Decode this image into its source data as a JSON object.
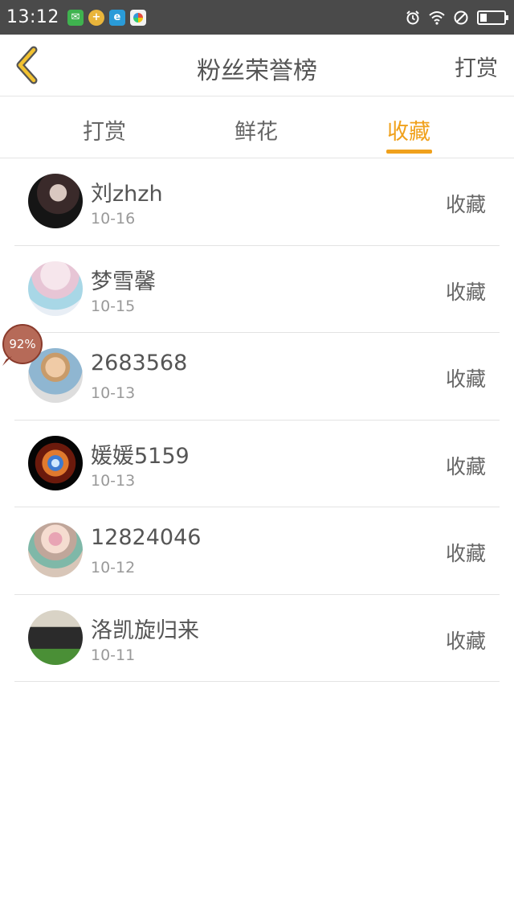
{
  "status_bar": {
    "time": "13:12",
    "battery_level": 0.3,
    "apps": [
      "wechat-icon",
      "plus-app-icon",
      "browser-e-icon",
      "photos-icon"
    ],
    "indicators": [
      "alarm-icon",
      "wifi-icon",
      "dnd-icon",
      "battery-icon"
    ]
  },
  "header": {
    "title": "粉丝荣誉榜",
    "right_label": "打赏",
    "back_icon": "back-chevron-icon"
  },
  "tabs": [
    {
      "label": "打赏",
      "active": false
    },
    {
      "label": "鲜花",
      "active": false
    },
    {
      "label": "收藏",
      "active": true
    }
  ],
  "accent_color": "#f0a11c",
  "list": [
    {
      "name": "刘zhzh",
      "date": "10-16",
      "action": "收藏"
    },
    {
      "name": "梦雪馨",
      "date": "10-15",
      "action": "收藏"
    },
    {
      "name": "2683568",
      "date": "10-13",
      "action": "收藏"
    },
    {
      "name": "媛媛5159",
      "date": "10-13",
      "action": "收藏"
    },
    {
      "name": "12824046",
      "date": "10-12",
      "action": "收藏"
    },
    {
      "name": "洛凯旋归来",
      "date": "10-11",
      "action": "收藏"
    }
  ],
  "float_badge": {
    "text": "92%"
  }
}
